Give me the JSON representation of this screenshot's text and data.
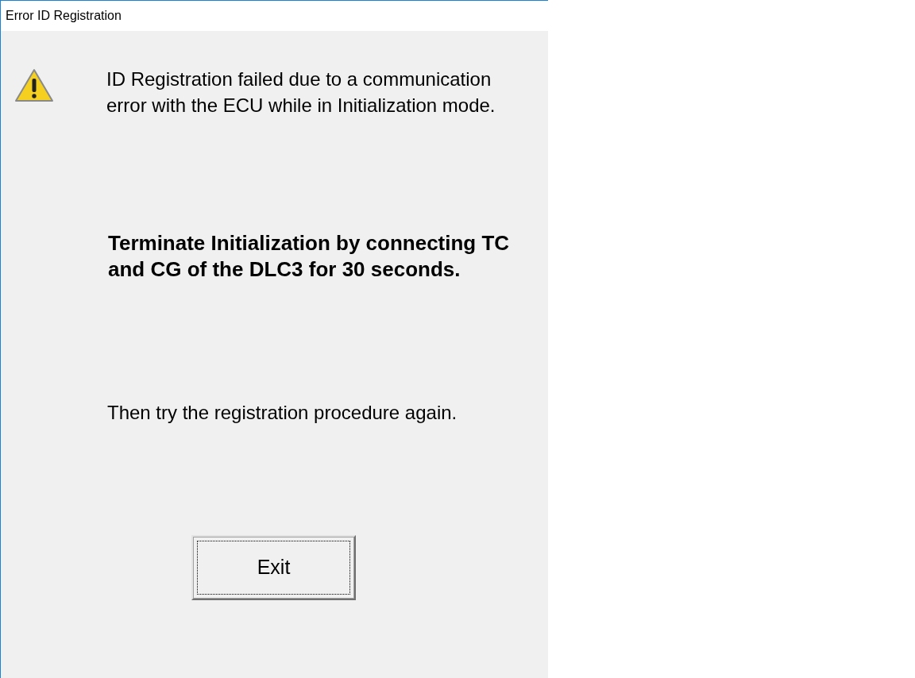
{
  "window": {
    "title": "Error ID Registration"
  },
  "message": "ID Registration failed due to a communication error with the ECU while in Initialization mode.",
  "instruction": "Terminate Initialization by connecting TC and CG of the DLC3 for 30 seconds.",
  "followup": "Then try the registration procedure again.",
  "button": {
    "label": "Exit",
    "focused": true
  }
}
